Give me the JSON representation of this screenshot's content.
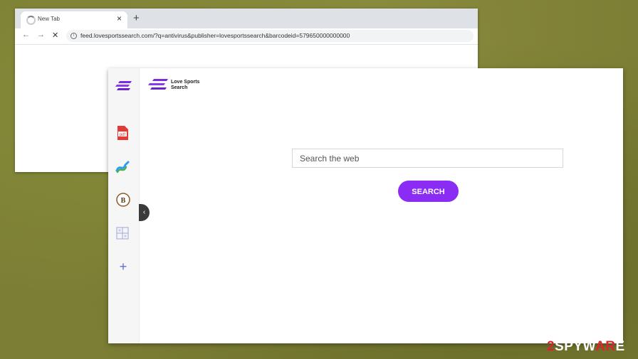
{
  "browser": {
    "tab_title": "New Tab",
    "close_glyph": "×",
    "new_tab_glyph": "+",
    "url": "feed.lovesportssearch.com/?q=antivirus&publisher=lovesportssearch&barcodeid=579650000000000",
    "nav": {
      "back": "←",
      "forward": "→",
      "stop": "✕"
    },
    "info_glyph": "i"
  },
  "page": {
    "brand_name": "Love Sports Search",
    "brand_color": "#8b2cf5",
    "search_placeholder": "Search the web",
    "search_button_label": "SEARCH",
    "sidebar_items": [
      {
        "icon": "pdf-icon",
        "label": "pdf"
      },
      {
        "icon": "stock-chart-icon"
      },
      {
        "icon": "bitcoin-icon",
        "label": "B"
      },
      {
        "icon": "grid-icon"
      },
      {
        "icon": "add-icon",
        "label": "+"
      }
    ],
    "toggle_glyph": "‹"
  },
  "watermark": {
    "prefix": "2",
    "middle": "SPYW",
    "accent": "AR",
    "suffix": "E"
  }
}
